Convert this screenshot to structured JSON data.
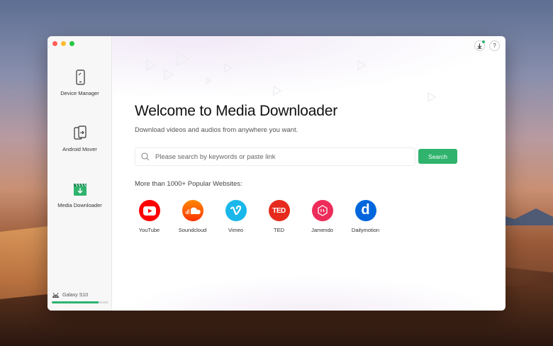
{
  "colors": {
    "accent": "#2fb36d",
    "youtube": "#ff0000",
    "soundcloud": "#ff5500",
    "vimeo": "#1ab7ea",
    "ted": "#e62b1e",
    "jamendo": "#ed2c5b",
    "dailymotion": "#0066dc"
  },
  "sidebar": {
    "items": [
      {
        "label": "Device Manager",
        "icon": "phone-icon"
      },
      {
        "label": "Android Mover",
        "icon": "transfer-icon"
      },
      {
        "label": "Media Downloader",
        "icon": "download-clapper-icon"
      }
    ],
    "device": {
      "name": "Galaxy S10",
      "icon": "android-icon",
      "storage_fraction": 0.83
    }
  },
  "header": {
    "download_icon": "download-icon",
    "help_label": "?"
  },
  "main": {
    "title": "Welcome to Media Downloader",
    "subtitle": "Download videos and audios from anywhere you want.",
    "search": {
      "placeholder": "Please search by keywords or paste link",
      "button_label": "Search"
    },
    "popular_label": "More than 1000+ Popular Websites:",
    "sites": [
      {
        "name": "YouTube",
        "icon": "youtube-icon"
      },
      {
        "name": "Soundcloud",
        "icon": "soundcloud-icon"
      },
      {
        "name": "Vimeo",
        "icon": "vimeo-icon"
      },
      {
        "name": "TED",
        "icon": "ted-icon",
        "logo_text": "TED"
      },
      {
        "name": "Jamendo",
        "icon": "jamendo-icon"
      },
      {
        "name": "Dailymotion",
        "icon": "dailymotion-icon",
        "logo_text": "d"
      }
    ]
  }
}
